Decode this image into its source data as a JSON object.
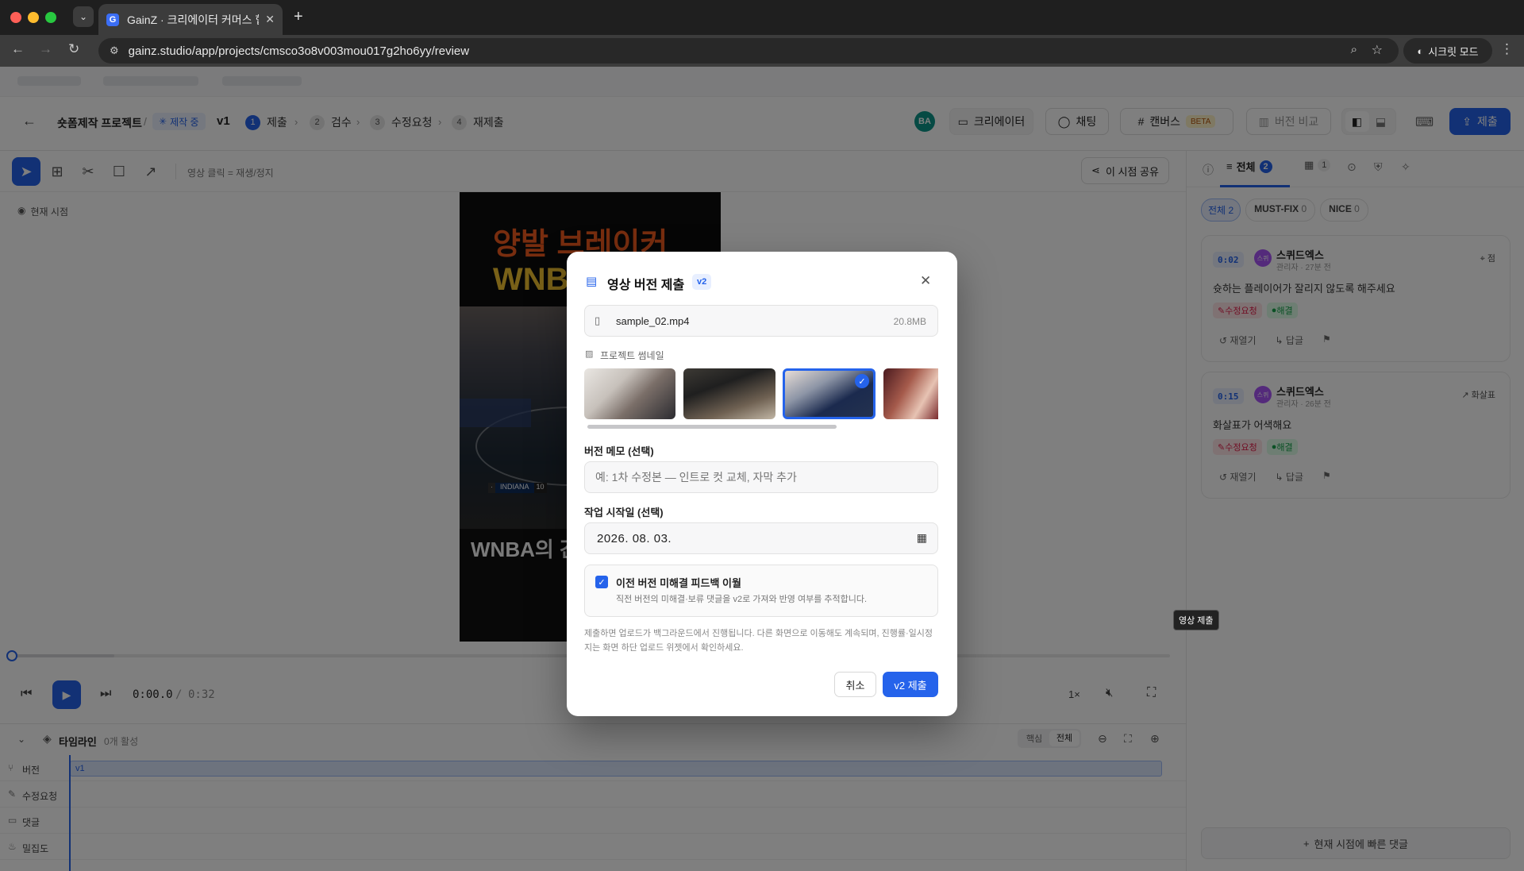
{
  "browser": {
    "tab_title": "GainZ · 크리에이터 커머스 협업 C",
    "favicon_letter": "G",
    "url": "gainz.studio/app/projects/cmsco3o8v003mou017g2ho6yy/review",
    "incognito_label": "시크릿 모드"
  },
  "header": {
    "project_name": "숏폼제작 프로젝트",
    "separator": "/",
    "status_badge": "제작 중",
    "version": "v1",
    "steps": [
      {
        "num": "1",
        "label": "제출"
      },
      {
        "num": "2",
        "label": "검수"
      },
      {
        "num": "3",
        "label": "수정요청"
      },
      {
        "num": "4",
        "label": "재제출"
      }
    ],
    "avatar_initials": "BA",
    "creator_button": "크리에이터",
    "chat_button": "채팅",
    "canvas_button": "캔버스",
    "canvas_badge": "BETA",
    "compare_button": "버전 비교",
    "submit_button": "제출"
  },
  "toolbar": {
    "hint": "영상 클릭 = 재생/정지",
    "share_button": "이 시점 공유",
    "current_time_label": "현재 시점"
  },
  "video": {
    "title_line1": "양발 브레이커",
    "title_line2": "WNBA",
    "score_team": "INDIANA",
    "score_num": "10",
    "bottom_caption": "WNBA의 간"
  },
  "player": {
    "current_time": "0:00.0",
    "time_sep": "/",
    "duration": "0:32",
    "speed": "1×"
  },
  "timeline": {
    "title": "타임라인",
    "active_count": "0개 활성",
    "toggle_core": "핵심",
    "toggle_all": "전체",
    "rows": [
      "버전",
      "수정요청",
      "댓글",
      "밀집도"
    ],
    "version_clip": "v1"
  },
  "sidebar": {
    "tab_all": "전체",
    "tab_all_count": "2",
    "tab_scenes_count": "1",
    "filters": [
      {
        "label": "전체",
        "count": "2"
      },
      {
        "label": "MUST-FIX",
        "count": "0"
      },
      {
        "label": "NICE",
        "count": "0"
      }
    ],
    "comments": [
      {
        "time": "0:02",
        "author": "스퀴드엑스",
        "avatar": "스퀴",
        "meta": "관리자 · 27분 전",
        "tag": "점",
        "body": "슛하는 플레이어가 잘리지 않도록 해주세요",
        "type": "수정요청",
        "status": "해결",
        "reopen": "재열기",
        "reply": "답글"
      },
      {
        "time": "0:15",
        "author": "스퀴드엑스",
        "avatar": "스퀴",
        "meta": "관리자 · 26분 전",
        "tag": "화살표",
        "body": "화살표가 어색해요",
        "type": "수정요청",
        "status": "해결",
        "reopen": "재열기",
        "reply": "답글"
      }
    ],
    "quick_comment": "현재 시점에 빠른 댓글"
  },
  "tooltip": "영상 제출",
  "modal": {
    "title": "영상 버전 제출",
    "version_badge": "v2",
    "file_name": "sample_02.mp4",
    "file_size": "20.8MB",
    "thumbnail_label": "프로젝트 썸네일",
    "memo_label": "버전 메모 (선택)",
    "memo_placeholder": "예: 1차 수정본 — 인트로 컷 교체, 자막 추가",
    "date_label": "작업 시작일 (선택)",
    "date_value": "2026. 08. 03.",
    "carry_title": "이전 버전 미해결 피드백 이월",
    "carry_desc": "직전 버전의 미해결·보류 댓글을 v2로 가져와 반영 여부를 추적합니다.",
    "notice": "제출하면 업로드가 백그라운드에서 진행됩니다. 다른 화면으로 이동해도 계속되며, 진행률·일시정지는 화면 하단 업로드 위젯에서 확인하세요.",
    "cancel_button": "취소",
    "confirm_button": "v2 제출"
  },
  "colors": {
    "accent": "#2563eb",
    "danger": "#e11d48",
    "success": "#16a34a"
  }
}
